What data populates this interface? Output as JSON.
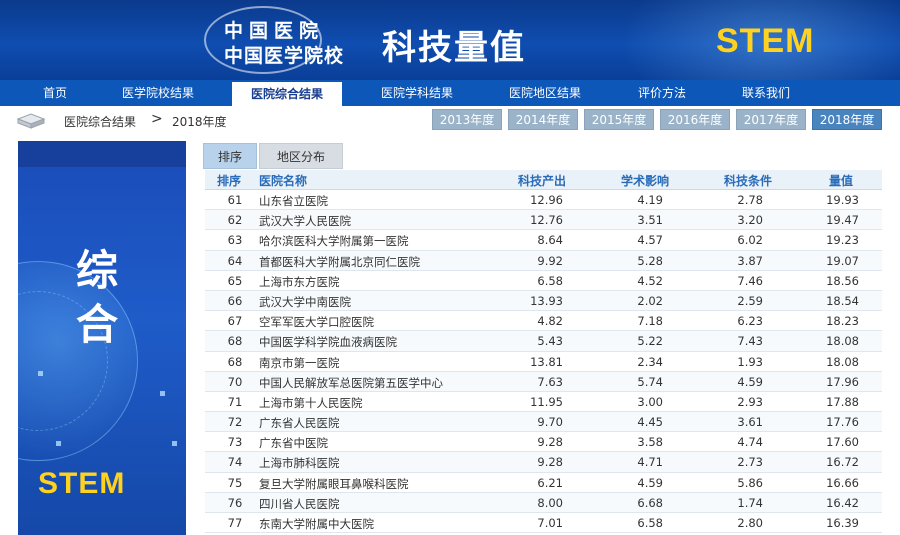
{
  "banner": {
    "line1": "中国医院",
    "line2": "中国医学院校",
    "title": "科技量值",
    "stem": "STEM"
  },
  "nav": {
    "items": [
      {
        "label": "首页"
      },
      {
        "label": "医学院校结果"
      },
      {
        "label": "医院综合结果",
        "active": true
      },
      {
        "label": "医院学科结果"
      },
      {
        "label": "医院地区结果"
      },
      {
        "label": "评价方法"
      },
      {
        "label": "联系我们"
      }
    ]
  },
  "breadcrumb": {
    "section": "医院综合结果",
    "separator": ">",
    "current": "2018年度"
  },
  "years": [
    {
      "label": "2013年度"
    },
    {
      "label": "2014年度"
    },
    {
      "label": "2015年度"
    },
    {
      "label": "2016年度"
    },
    {
      "label": "2017年度"
    },
    {
      "label": "2018年度",
      "active": true
    }
  ],
  "side": {
    "char1": "综",
    "char2": "合",
    "stem": "STEM"
  },
  "tabs": [
    {
      "label": "排序",
      "active": true
    },
    {
      "label": "地区分布"
    }
  ],
  "table": {
    "headers": {
      "rank": "排序",
      "name": "医院名称",
      "output": "科技产出",
      "impact": "学术影响",
      "condition": "科技条件",
      "score": "量值"
    },
    "rows": [
      {
        "rank": "61",
        "name": "山东省立医院",
        "output": "12.96",
        "impact": "4.19",
        "condition": "2.78",
        "score": "19.93"
      },
      {
        "rank": "62",
        "name": "武汉大学人民医院",
        "output": "12.76",
        "impact": "3.51",
        "condition": "3.20",
        "score": "19.47"
      },
      {
        "rank": "63",
        "name": "哈尔滨医科大学附属第一医院",
        "output": "8.64",
        "impact": "4.57",
        "condition": "6.02",
        "score": "19.23"
      },
      {
        "rank": "64",
        "name": "首都医科大学附属北京同仁医院",
        "output": "9.92",
        "impact": "5.28",
        "condition": "3.87",
        "score": "19.07"
      },
      {
        "rank": "65",
        "name": "上海市东方医院",
        "output": "6.58",
        "impact": "4.52",
        "condition": "7.46",
        "score": "18.56"
      },
      {
        "rank": "66",
        "name": "武汉大学中南医院",
        "output": "13.93",
        "impact": "2.02",
        "condition": "2.59",
        "score": "18.54"
      },
      {
        "rank": "67",
        "name": "空军军医大学口腔医院",
        "output": "4.82",
        "impact": "7.18",
        "condition": "6.23",
        "score": "18.23"
      },
      {
        "rank": "68",
        "name": "中国医学科学院血液病医院",
        "output": "5.43",
        "impact": "5.22",
        "condition": "7.43",
        "score": "18.08"
      },
      {
        "rank": "68",
        "name": "南京市第一医院",
        "output": "13.81",
        "impact": "2.34",
        "condition": "1.93",
        "score": "18.08"
      },
      {
        "rank": "70",
        "name": "中国人民解放军总医院第五医学中心",
        "output": "7.63",
        "impact": "5.74",
        "condition": "4.59",
        "score": "17.96"
      },
      {
        "rank": "71",
        "name": "上海市第十人民医院",
        "output": "11.95",
        "impact": "3.00",
        "condition": "2.93",
        "score": "17.88"
      },
      {
        "rank": "72",
        "name": "广东省人民医院",
        "output": "9.70",
        "impact": "4.45",
        "condition": "3.61",
        "score": "17.76"
      },
      {
        "rank": "73",
        "name": "广东省中医院",
        "output": "9.28",
        "impact": "3.58",
        "condition": "4.74",
        "score": "17.60"
      },
      {
        "rank": "74",
        "name": "上海市肺科医院",
        "output": "9.28",
        "impact": "4.71",
        "condition": "2.73",
        "score": "16.72"
      },
      {
        "rank": "75",
        "name": "复旦大学附属眼耳鼻喉科医院",
        "output": "6.21",
        "impact": "4.59",
        "condition": "5.86",
        "score": "16.66"
      },
      {
        "rank": "76",
        "name": "四川省人民医院",
        "output": "8.00",
        "impact": "6.68",
        "condition": "1.74",
        "score": "16.42"
      },
      {
        "rank": "77",
        "name": "东南大学附属中大医院",
        "output": "7.01",
        "impact": "6.58",
        "condition": "2.80",
        "score": "16.39"
      }
    ]
  },
  "colors": {
    "banner_blue": "#0f4db0",
    "nav_blue": "#0c57b8",
    "stem_yellow": "#ffd21f",
    "year_inactive": "#9ab3c9",
    "year_active": "#4a84bf",
    "header_text": "#2a6cb8"
  },
  "icons": {
    "breadcrumb": "book-stack-icon"
  }
}
